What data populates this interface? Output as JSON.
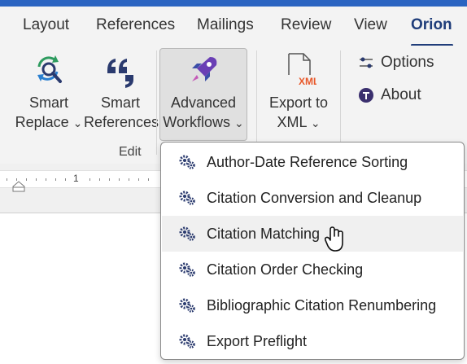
{
  "tabs": [
    {
      "label": "Layout"
    },
    {
      "label": "References"
    },
    {
      "label": "Mailings"
    },
    {
      "label": "Review"
    },
    {
      "label": "View"
    },
    {
      "label": "Orion",
      "active": true
    }
  ],
  "ribbon": {
    "smart_replace": {
      "line1": "Smart",
      "line2": "Replace",
      "chevron": "⌄"
    },
    "smart_references": {
      "line1": "Smart",
      "line2": "References"
    },
    "advanced_workflows": {
      "line1": "Advanced",
      "line2": "Workflows",
      "chevron": "⌄"
    },
    "export_xml": {
      "line1": "Export to",
      "line2": "XML",
      "chevron": "⌄",
      "icon_text": "XML"
    },
    "group_label": "Edit",
    "options_label": "Options",
    "about_label": "About"
  },
  "ruler": {
    "mark": "1"
  },
  "menu": {
    "items": [
      {
        "label": "Author-Date Reference Sorting"
      },
      {
        "label": "Citation Conversion and Cleanup"
      },
      {
        "label": "Citation Matching"
      },
      {
        "label": "Citation Order Checking"
      },
      {
        "label": "Bibliographic Citation Renumbering"
      },
      {
        "label": "Export Preflight"
      }
    ]
  },
  "colors": {
    "accent": "#1f3d7a",
    "titlebar": "#2b64c1",
    "gear": "#2a3a6e",
    "xml": "#e8582a",
    "rocket": "#6a3fb5"
  }
}
